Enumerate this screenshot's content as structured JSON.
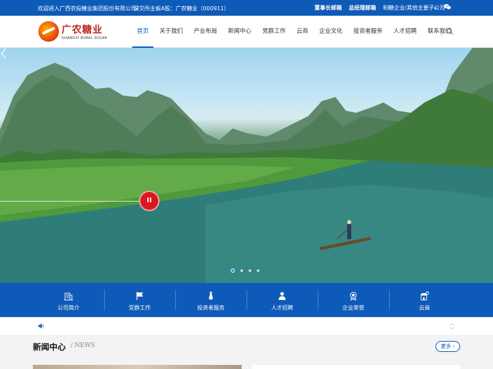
{
  "topbar": {
    "welcome": "欢迎进入广西农投糖业集团股份有限公司！",
    "stock": "深交所主板A股：广农糖业（000911）",
    "links": [
      "董事长邮箱",
      "总经理邮箱",
      "制糖企业/其他主要子公司"
    ],
    "dropdown_icon": "chevron-down-icon",
    "social_icon": "wechat-icon"
  },
  "logo": {
    "cn": "广农糖业",
    "en": "GUANGXI RURAL SUGAR"
  },
  "nav": {
    "items": [
      "首页",
      "关于我们",
      "产业布局",
      "新闻中心",
      "党群工作",
      "云商",
      "企业文化",
      "投资者服务",
      "人才招聘",
      "联系我们"
    ],
    "active_index": 0,
    "search_icon": "search-icon"
  },
  "banner": {
    "play_label": "II",
    "slide_count": 4,
    "active_slide": 0
  },
  "quick_links": [
    {
      "label": "公司简介",
      "icon": "building-icon"
    },
    {
      "label": "党群工作",
      "icon": "flag-icon"
    },
    {
      "label": "投资者服务",
      "icon": "tie-icon"
    },
    {
      "label": "人才招聘",
      "icon": "people-icon"
    },
    {
      "label": "企业荣誉",
      "icon": "medal-icon"
    },
    {
      "label": "云商",
      "icon": "shop-icon"
    }
  ],
  "notice": {
    "icon": "speaker-icon"
  },
  "news": {
    "title": "新闻中心",
    "subtitle": "/ NEWS",
    "more_label": "更多 ›"
  },
  "colors": {
    "primary": "#0e5ab8",
    "play": "#d9181d",
    "logo_red": "#c0261a"
  }
}
